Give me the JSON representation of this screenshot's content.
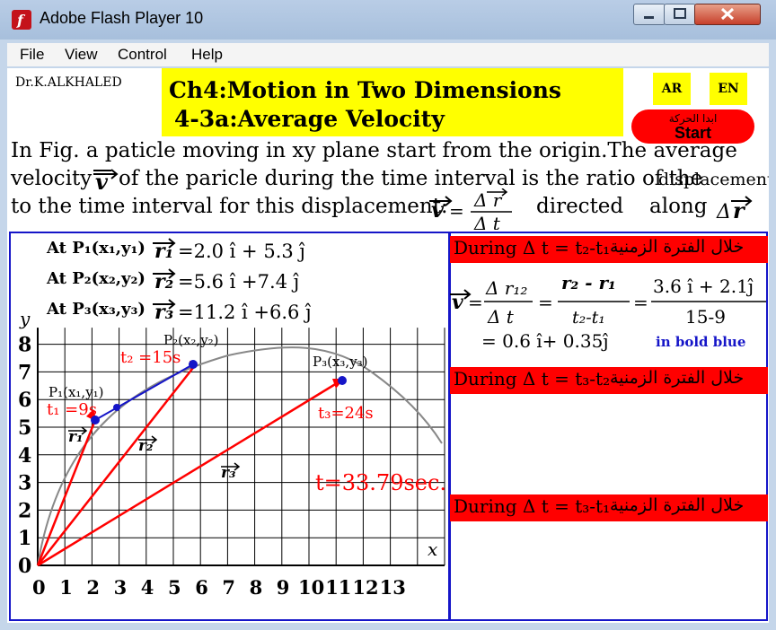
{
  "window": {
    "title": "Adobe Flash Player 10"
  },
  "menu": {
    "items": [
      "File",
      "View",
      "Control",
      "Help"
    ]
  },
  "header": {
    "author": "Dr.K.ALKHALED",
    "title_line1": "Ch4:Motion in Two Dimensions",
    "title_line2": "4-3a:Average Velocity",
    "lang_ar": "AR",
    "lang_en": "EN",
    "start_ar": "ابدا الحركة",
    "start_en": "Start"
  },
  "intro": {
    "line1": "In Fig. a paticle moving in xy plane start from the origin.The average",
    "line2a": "velocity",
    "line2b": "of the pariclе during the time interval is the ratio of the",
    "line2c": "displacement",
    "line3a": "to the time interval for this displacement:",
    "line3b": "directed",
    "line3c": "along",
    "delta_r": "Δ r",
    "delta_t": "Δ t"
  },
  "points": {
    "p1": {
      "label": "At P₁(x₁,y₁)",
      "vec": "r₁",
      "eq": "=2.0 î + 5.3 ĵ"
    },
    "p2": {
      "label": "At P₂(x₂,y₂)",
      "vec": "r₂",
      "eq": "=5.6 î +7.4 ĵ"
    },
    "p3": {
      "label": "At P₃(x₃,y₃)",
      "vec": "r₃",
      "eq": "=11.2 î +6.6 ĵ"
    }
  },
  "graph": {
    "y_label": "y",
    "x_label": "x",
    "x_ticks": [
      "0",
      "1",
      "2",
      "3",
      "4",
      "5",
      "6",
      "7",
      "8",
      "9",
      "10",
      "11",
      "12",
      "13"
    ],
    "y_ticks": [
      "0",
      "1",
      "2",
      "3",
      "4",
      "5",
      "6",
      "7",
      "8"
    ],
    "p1_tag": "P₁(x₁,y₁)",
    "p2_tag": "P₂(x₂,y₂)",
    "p3_tag": "P₃(x₃,y₃)",
    "t1_tag": "t₁ =9s",
    "t2_tag": "t₂ =15s",
    "t3_tag": "t₃=24s",
    "r1_tag": "r₁",
    "r2_tag": "r₂",
    "r3_tag": "r₃",
    "timer": "t=33.79sec."
  },
  "right_panel": {
    "band1_during": "During Δ t = t₂-t₁",
    "band1_ar": "خلال الفترة الزمنية",
    "band2_during": "During Δ t = t₃-t₂",
    "band2_ar": "خلال الفترة الزمنية",
    "band3_during": "During Δ t = t₃-t₁",
    "band3_ar": "خلال الفترة الزمنية",
    "calc_lhs_num": "Δ r₁₂",
    "calc_lhs_den": "Δ t",
    "calc_mid_num": "r₂ - r₁",
    "calc_mid_den": "t₂-t₁",
    "calc_rhs_num": "3.6 î + 2.1ĵ",
    "calc_rhs_den": "15-9",
    "calc_result": "= 0.6 î+ 0.35ĵ",
    "note": "in bold blue"
  }
}
